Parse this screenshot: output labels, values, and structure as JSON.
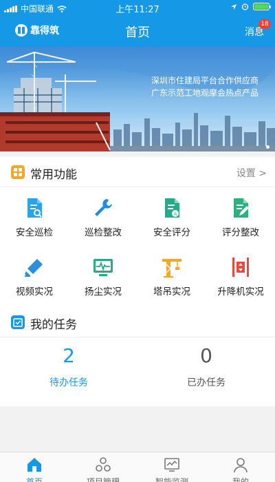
{
  "status_bar": {
    "carrier": "中国联通",
    "time": "上午11:27"
  },
  "nav": {
    "brand": "靠得筑",
    "title": "首页",
    "messages_label": "消息",
    "messages_badge": "18"
  },
  "banner": {
    "line1": "深圳市住建局平台合作供应商",
    "line2": "广东示范工地观摩会热点产品"
  },
  "common_functions": {
    "title": "常用功能",
    "settings_label": "设置 >",
    "items": [
      {
        "label": "安全巡检",
        "icon": "document-search-icon",
        "color": "#29a3e9"
      },
      {
        "label": "巡检整改",
        "icon": "wrench-icon",
        "color": "#1c8ee0"
      },
      {
        "label": "安全评分",
        "icon": "document-score-icon",
        "color": "#27a98a"
      },
      {
        "label": "评分整改",
        "icon": "document-edit-icon",
        "color": "#2bb07e"
      },
      {
        "label": "视频实况",
        "icon": "camera-icon",
        "color": "#2b8fe0"
      },
      {
        "label": "扬尘实况",
        "icon": "monitor-wave-icon",
        "color": "#27a98a"
      },
      {
        "label": "塔吊实况",
        "icon": "tower-crane-icon",
        "color": "#f6a623"
      },
      {
        "label": "升降机实况",
        "icon": "elevator-icon",
        "color": "#e8493d"
      }
    ]
  },
  "my_tasks": {
    "title": "我的任务",
    "pending_count": "2",
    "pending_label": "待办任务",
    "done_count": "0",
    "done_label": "已办任务",
    "pending_color": "#1598e6",
    "done_color": "#555555"
  },
  "tabbar": {
    "items": [
      {
        "label": "首页",
        "icon": "home-icon",
        "active": true
      },
      {
        "label": "项目管理",
        "icon": "nodes-icon",
        "active": false
      },
      {
        "label": "智能监测",
        "icon": "monitor-chart-icon",
        "active": false
      },
      {
        "label": "我的",
        "icon": "user-icon",
        "active": false
      }
    ]
  },
  "colors": {
    "primary": "#1598e6",
    "accent_orange": "#f6a623"
  }
}
